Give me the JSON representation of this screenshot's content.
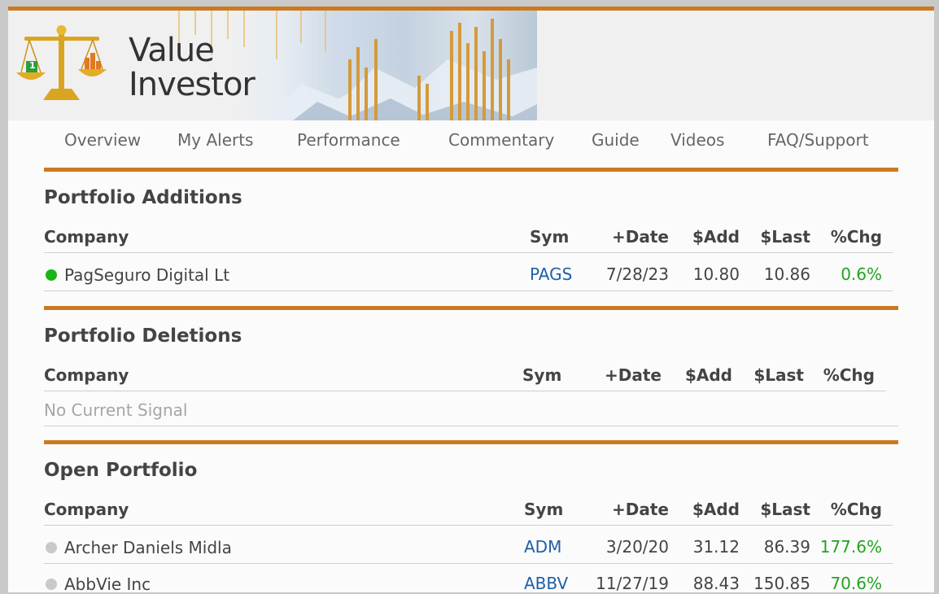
{
  "brand": {
    "title_line1": "Value",
    "title_line2": "Investor",
    "logo_badge_number": "1",
    "accent_color": "#cc7a22",
    "link_color": "#1f5fa6",
    "gain_color": "#22a322"
  },
  "nav": {
    "items": [
      "Overview",
      "My Alerts",
      "Performance",
      "Commentary",
      "Guide",
      "Videos",
      "FAQ/Support"
    ]
  },
  "columns": {
    "company": "Company",
    "sym": "Sym",
    "date": "+Date",
    "add": "$Add",
    "last": "$Last",
    "chg": "%Chg"
  },
  "additions": {
    "title": "Portfolio Additions",
    "rows": [
      {
        "status": "green",
        "company": "PagSeguro Digital Lt",
        "sym": "PAGS",
        "date": "7/28/23",
        "add": "10.80",
        "last": "10.86",
        "chg": "0.6%"
      }
    ]
  },
  "deletions": {
    "title": "Portfolio Deletions",
    "empty_text": "No Current Signal"
  },
  "open": {
    "title": "Open Portfolio",
    "rows": [
      {
        "status": "gray",
        "company": "Archer Daniels Midla",
        "sym": "ADM",
        "date": "3/20/20",
        "add": "31.12",
        "last": "86.39",
        "chg": "177.6%"
      },
      {
        "status": "gray",
        "company": "AbbVie Inc",
        "sym": "ABBV",
        "date": "11/27/19",
        "add": "88.43",
        "last": "150.85",
        "chg": "70.6%"
      }
    ]
  }
}
